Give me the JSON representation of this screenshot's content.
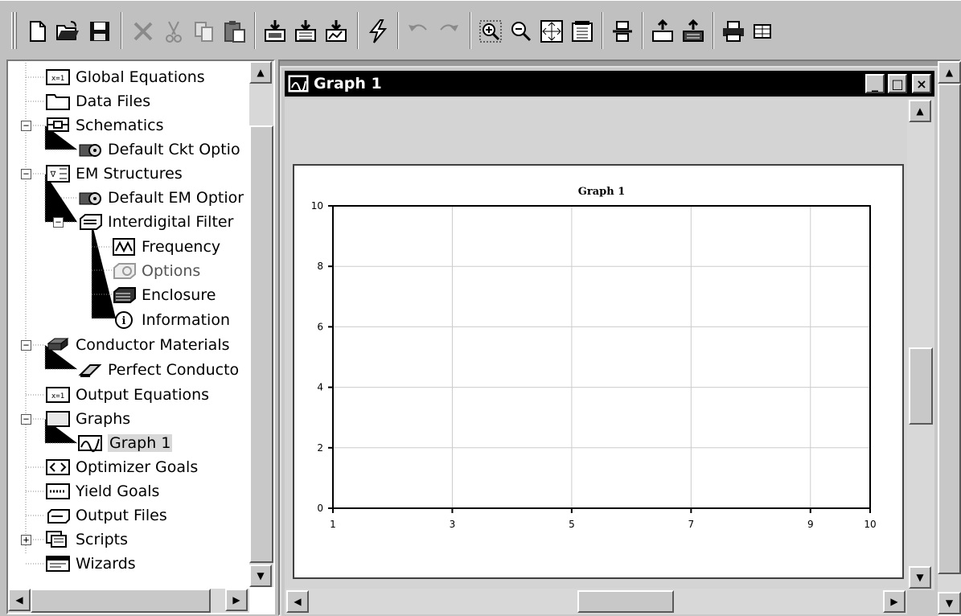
{
  "toolbar": {
    "buttons": [
      "new-icon",
      "open-icon",
      "save-icon",
      "delete-icon",
      "cut-icon",
      "copy-icon",
      "paste-icon",
      "add-schematic-icon",
      "add-em-structure-icon",
      "add-graph-icon",
      "analyze-icon",
      "undo-icon",
      "redo-icon",
      "zoom-area-icon",
      "zoom-out-icon",
      "view-all-icon",
      "properties-icon",
      "layout-icon",
      "import-icon",
      "export-icon",
      "print-icon",
      "grid-icon"
    ]
  },
  "tree": {
    "items": [
      {
        "label": "Global Equations",
        "icon": "equations-icon"
      },
      {
        "label": "Data Files",
        "icon": "folder-icon"
      },
      {
        "label": "Schematics",
        "icon": "schematic-icon"
      },
      {
        "label": "Default Ckt Optio",
        "icon": "options-icon"
      },
      {
        "label": "EM Structures",
        "icon": "em-structure-icon"
      },
      {
        "label": "Default EM Optior",
        "icon": "options-icon"
      },
      {
        "label": "Interdigital Filter",
        "icon": "filter-icon"
      },
      {
        "label": "Frequency",
        "icon": "frequency-icon"
      },
      {
        "label": "Options",
        "icon": "options-icon"
      },
      {
        "label": "Enclosure",
        "icon": "enclosure-icon"
      },
      {
        "label": "Information",
        "icon": "info-icon"
      },
      {
        "label": "Conductor Materials",
        "icon": "conductor-icon"
      },
      {
        "label": "Perfect Conducto",
        "icon": "eraser-icon"
      },
      {
        "label": "Output Equations",
        "icon": "equations-icon"
      },
      {
        "label": "Graphs",
        "icon": "graphs-icon"
      },
      {
        "label": "Graph 1",
        "icon": "graph-icon"
      },
      {
        "label": "Optimizer Goals",
        "icon": "goals-icon"
      },
      {
        "label": "Yield Goals",
        "icon": "yield-icon"
      },
      {
        "label": "Output Files",
        "icon": "output-file-icon"
      },
      {
        "label": "Scripts",
        "icon": "scripts-icon"
      },
      {
        "label": "Wizards",
        "icon": "wizards-icon"
      }
    ]
  },
  "window": {
    "title": "Graph 1",
    "minimize": "_",
    "maximize": "□",
    "close": "×"
  },
  "chart_data": {
    "type": "line",
    "title": "Graph 1",
    "series": [],
    "xlim": [
      1,
      10
    ],
    "ylim": [
      0,
      10
    ],
    "xticks": [
      "1",
      "3",
      "5",
      "7",
      "9",
      "10"
    ],
    "yticks": [
      "0",
      "2",
      "4",
      "6",
      "8",
      "10"
    ],
    "grid": true
  },
  "colors": {
    "title_bar": "#000000",
    "pane": "#c0c0c0",
    "plot_bg": "#ffffff",
    "grid": "#cccccc"
  }
}
